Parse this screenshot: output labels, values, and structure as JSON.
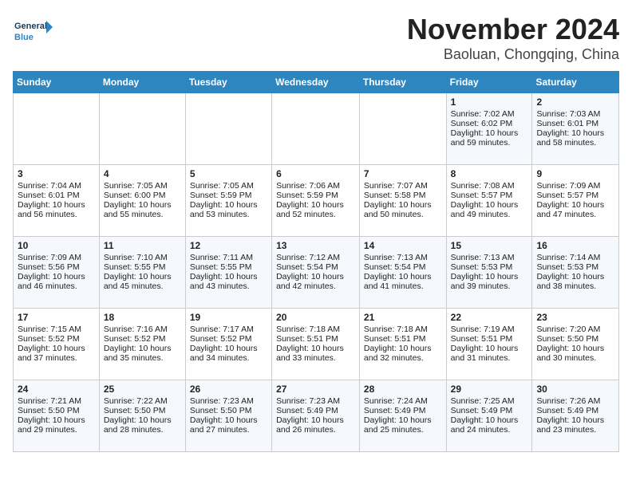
{
  "header": {
    "logo_general": "General",
    "logo_blue": "Blue",
    "month": "November 2024",
    "location": "Baoluan, Chongqing, China"
  },
  "days_of_week": [
    "Sunday",
    "Monday",
    "Tuesday",
    "Wednesday",
    "Thursday",
    "Friday",
    "Saturday"
  ],
  "weeks": [
    [
      {
        "day": "",
        "info": ""
      },
      {
        "day": "",
        "info": ""
      },
      {
        "day": "",
        "info": ""
      },
      {
        "day": "",
        "info": ""
      },
      {
        "day": "",
        "info": ""
      },
      {
        "day": "1",
        "info": "Sunrise: 7:02 AM\nSunset: 6:02 PM\nDaylight: 10 hours and 59 minutes."
      },
      {
        "day": "2",
        "info": "Sunrise: 7:03 AM\nSunset: 6:01 PM\nDaylight: 10 hours and 58 minutes."
      }
    ],
    [
      {
        "day": "3",
        "info": "Sunrise: 7:04 AM\nSunset: 6:01 PM\nDaylight: 10 hours and 56 minutes."
      },
      {
        "day": "4",
        "info": "Sunrise: 7:05 AM\nSunset: 6:00 PM\nDaylight: 10 hours and 55 minutes."
      },
      {
        "day": "5",
        "info": "Sunrise: 7:05 AM\nSunset: 5:59 PM\nDaylight: 10 hours and 53 minutes."
      },
      {
        "day": "6",
        "info": "Sunrise: 7:06 AM\nSunset: 5:59 PM\nDaylight: 10 hours and 52 minutes."
      },
      {
        "day": "7",
        "info": "Sunrise: 7:07 AM\nSunset: 5:58 PM\nDaylight: 10 hours and 50 minutes."
      },
      {
        "day": "8",
        "info": "Sunrise: 7:08 AM\nSunset: 5:57 PM\nDaylight: 10 hours and 49 minutes."
      },
      {
        "day": "9",
        "info": "Sunrise: 7:09 AM\nSunset: 5:57 PM\nDaylight: 10 hours and 47 minutes."
      }
    ],
    [
      {
        "day": "10",
        "info": "Sunrise: 7:09 AM\nSunset: 5:56 PM\nDaylight: 10 hours and 46 minutes."
      },
      {
        "day": "11",
        "info": "Sunrise: 7:10 AM\nSunset: 5:55 PM\nDaylight: 10 hours and 45 minutes."
      },
      {
        "day": "12",
        "info": "Sunrise: 7:11 AM\nSunset: 5:55 PM\nDaylight: 10 hours and 43 minutes."
      },
      {
        "day": "13",
        "info": "Sunrise: 7:12 AM\nSunset: 5:54 PM\nDaylight: 10 hours and 42 minutes."
      },
      {
        "day": "14",
        "info": "Sunrise: 7:13 AM\nSunset: 5:54 PM\nDaylight: 10 hours and 41 minutes."
      },
      {
        "day": "15",
        "info": "Sunrise: 7:13 AM\nSunset: 5:53 PM\nDaylight: 10 hours and 39 minutes."
      },
      {
        "day": "16",
        "info": "Sunrise: 7:14 AM\nSunset: 5:53 PM\nDaylight: 10 hours and 38 minutes."
      }
    ],
    [
      {
        "day": "17",
        "info": "Sunrise: 7:15 AM\nSunset: 5:52 PM\nDaylight: 10 hours and 37 minutes."
      },
      {
        "day": "18",
        "info": "Sunrise: 7:16 AM\nSunset: 5:52 PM\nDaylight: 10 hours and 35 minutes."
      },
      {
        "day": "19",
        "info": "Sunrise: 7:17 AM\nSunset: 5:52 PM\nDaylight: 10 hours and 34 minutes."
      },
      {
        "day": "20",
        "info": "Sunrise: 7:18 AM\nSunset: 5:51 PM\nDaylight: 10 hours and 33 minutes."
      },
      {
        "day": "21",
        "info": "Sunrise: 7:18 AM\nSunset: 5:51 PM\nDaylight: 10 hours and 32 minutes."
      },
      {
        "day": "22",
        "info": "Sunrise: 7:19 AM\nSunset: 5:51 PM\nDaylight: 10 hours and 31 minutes."
      },
      {
        "day": "23",
        "info": "Sunrise: 7:20 AM\nSunset: 5:50 PM\nDaylight: 10 hours and 30 minutes."
      }
    ],
    [
      {
        "day": "24",
        "info": "Sunrise: 7:21 AM\nSunset: 5:50 PM\nDaylight: 10 hours and 29 minutes."
      },
      {
        "day": "25",
        "info": "Sunrise: 7:22 AM\nSunset: 5:50 PM\nDaylight: 10 hours and 28 minutes."
      },
      {
        "day": "26",
        "info": "Sunrise: 7:23 AM\nSunset: 5:50 PM\nDaylight: 10 hours and 27 minutes."
      },
      {
        "day": "27",
        "info": "Sunrise: 7:23 AM\nSunset: 5:49 PM\nDaylight: 10 hours and 26 minutes."
      },
      {
        "day": "28",
        "info": "Sunrise: 7:24 AM\nSunset: 5:49 PM\nDaylight: 10 hours and 25 minutes."
      },
      {
        "day": "29",
        "info": "Sunrise: 7:25 AM\nSunset: 5:49 PM\nDaylight: 10 hours and 24 minutes."
      },
      {
        "day": "30",
        "info": "Sunrise: 7:26 AM\nSunset: 5:49 PM\nDaylight: 10 hours and 23 minutes."
      }
    ]
  ]
}
